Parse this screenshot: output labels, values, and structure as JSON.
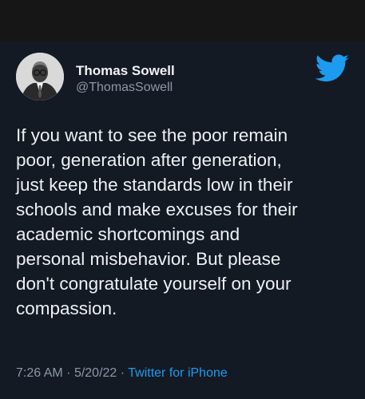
{
  "tweet": {
    "author": {
      "name": "Thomas Sowell",
      "handle": "@ThomasSowell"
    },
    "lines": [
      "If you want to see the poor remain",
      "poor, generation after generation,",
      "just keep the standards low in their",
      "schools and make excuses for their",
      "academic shortcomings and",
      "personal misbehavior. But please",
      "don't congratulate yourself on your",
      "compassion."
    ],
    "time": "7:26 AM",
    "date": "5/20/22",
    "separator": "·",
    "source": "Twitter for iPhone"
  },
  "icons": {
    "logo": "twitter-bird-icon",
    "avatar": "profile-photo"
  },
  "colors": {
    "background": "#141a24",
    "text": "#eef1f4",
    "secondary_text": "#8b98a5",
    "accent": "#1d9bf0"
  }
}
